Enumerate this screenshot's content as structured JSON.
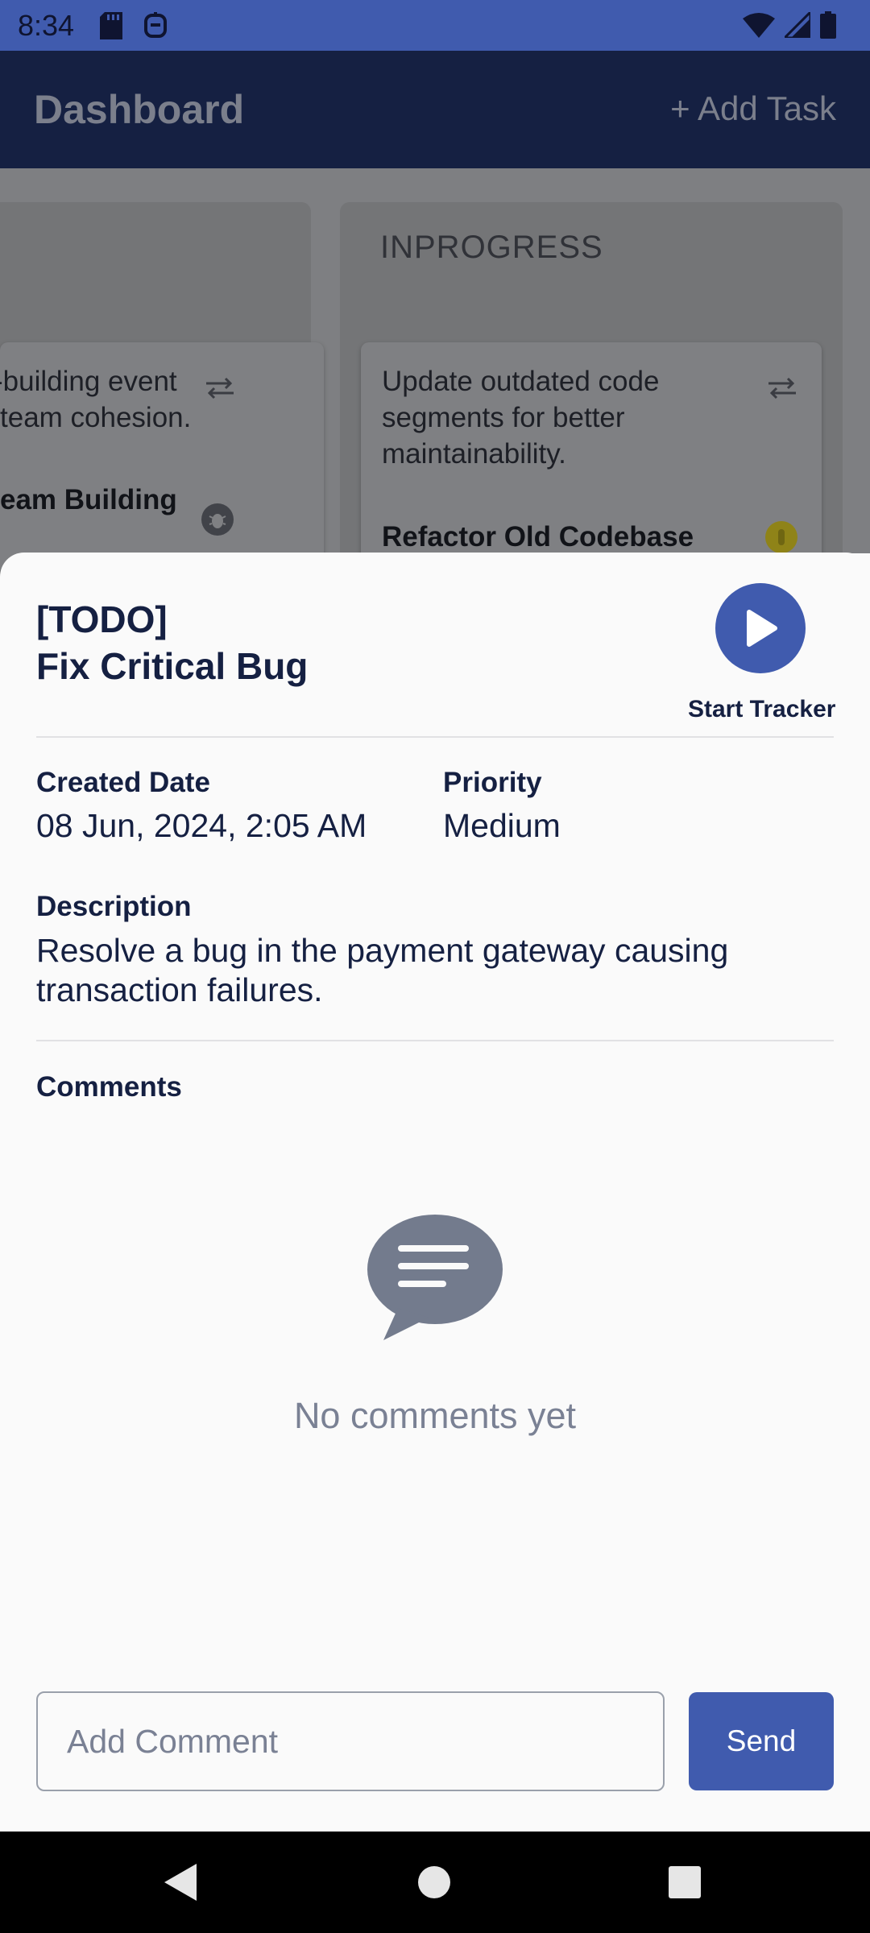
{
  "status_bar": {
    "time": "8:34",
    "icons": [
      "sd-card-icon",
      "notification-icon",
      "wifi-icon",
      "signal-icon",
      "battery-icon"
    ]
  },
  "app_bar": {
    "title": "Dashboard",
    "add_task_label": "+ Add Task"
  },
  "board": {
    "left_card": {
      "description": "-building event\nteam cohesion.",
      "title": "eam Building"
    },
    "right_column": {
      "title": "INPROGRESS",
      "card": {
        "description": "Update outdated code segments for better maintainability.",
        "title": "Refactor Old Codebase"
      }
    }
  },
  "task_sheet": {
    "status": "[TODO]",
    "title": "Fix Critical Bug",
    "tracker_label": "Start Tracker",
    "created_date_label": "Created Date",
    "created_date_value": "08 Jun, 2024, 2:05 AM",
    "priority_label": "Priority",
    "priority_value": "Medium",
    "description_label": "Description",
    "description_value": "Resolve a bug in the payment gateway causing transaction failures.",
    "comments_label": "Comments",
    "empty_comments": "No comments yet",
    "comment_placeholder": "Add Comment",
    "send_label": "Send"
  },
  "colors": {
    "primary": "#405bae",
    "app_bar": "#152042",
    "text_dark": "#152042",
    "muted": "#7a8194",
    "priority_medium_badge": "#c9b41a"
  }
}
